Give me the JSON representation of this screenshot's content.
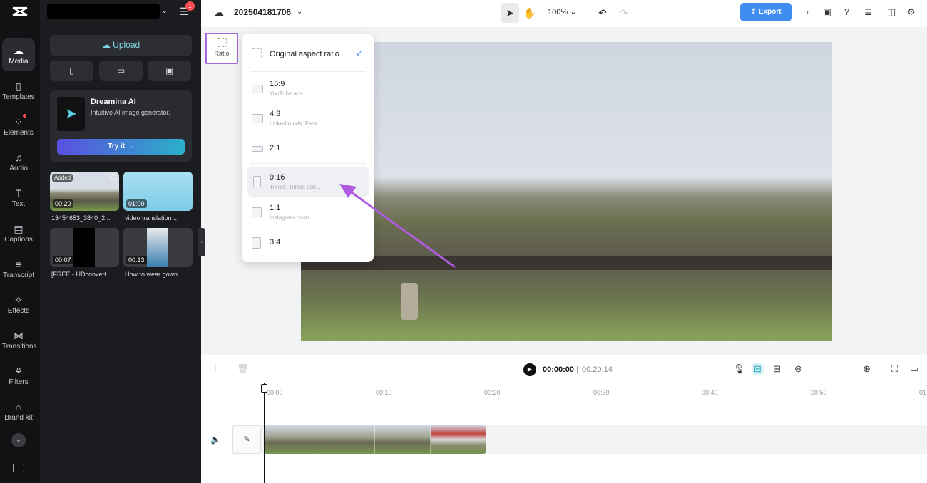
{
  "nav": {
    "items": [
      {
        "name": "media",
        "label": "Media",
        "icon": "cloud-icon",
        "active": true
      },
      {
        "name": "templates",
        "label": "Templates",
        "icon": "template-icon"
      },
      {
        "name": "elements",
        "label": "Elements",
        "icon": "elements-icon",
        "dot": true
      },
      {
        "name": "audio",
        "label": "Audio",
        "icon": "music-icon"
      },
      {
        "name": "text",
        "label": "Text",
        "icon": "text-icon"
      },
      {
        "name": "captions",
        "label": "Captions",
        "icon": "captions-icon"
      },
      {
        "name": "transcript",
        "label": "Transcript",
        "icon": "transcript-icon"
      },
      {
        "name": "effects",
        "label": "Effects",
        "icon": "effects-icon"
      },
      {
        "name": "transitions",
        "label": "Transitions",
        "icon": "transitions-icon"
      },
      {
        "name": "filters",
        "label": "Filters",
        "icon": "filters-icon"
      },
      {
        "name": "brand-kit",
        "label": "Brand kit",
        "icon": "brand-kit-icon"
      }
    ]
  },
  "panel": {
    "notification_count": "1",
    "upload_label": "Upload",
    "promo": {
      "title": "Dreamina AI",
      "subtitle": "Intuitive AI image generator.",
      "cta": "Try it →"
    },
    "media": [
      {
        "duration": "00:20",
        "caption": "13454653_3840_2...",
        "added": "Added"
      },
      {
        "duration": "01:00",
        "caption": "video translation ..."
      },
      {
        "duration": "00:07",
        "caption": "[FREE - HDconvert..."
      },
      {
        "duration": "00:13",
        "caption": "How to wear gown ..."
      }
    ]
  },
  "topbar": {
    "project_name": "202504181706",
    "zoom": "100%",
    "export_label": "Export"
  },
  "ratio": {
    "button_label": "Ratio",
    "menu": [
      {
        "name": "Original aspect ratio",
        "desc": "",
        "selected": true
      },
      {
        "name": "16:9",
        "desc": "YouTube ads"
      },
      {
        "name": "4:3",
        "desc": "LinkedIn ads, Face..."
      },
      {
        "name": "2:1",
        "desc": ""
      },
      {
        "name": "9:16",
        "desc": "TikTok, TikTok ads...",
        "highlighted": true
      },
      {
        "name": "1:1",
        "desc": "Instagram posts"
      },
      {
        "name": "3:4",
        "desc": ""
      }
    ]
  },
  "playback": {
    "current": "00:00:00",
    "separator": "|",
    "total": "00:20:14"
  },
  "timeline": {
    "ticks": [
      "00:00",
      "00:10",
      "00:20",
      "00:30",
      "00:40",
      "00:50",
      "01"
    ]
  },
  "colors": {
    "accent": "#3f8cf2",
    "highlight_outline": "#a667d8",
    "annotation_arrow": "#b05ce0",
    "nav_bg": "#111214",
    "panel_bg": "#1b1c1f"
  }
}
